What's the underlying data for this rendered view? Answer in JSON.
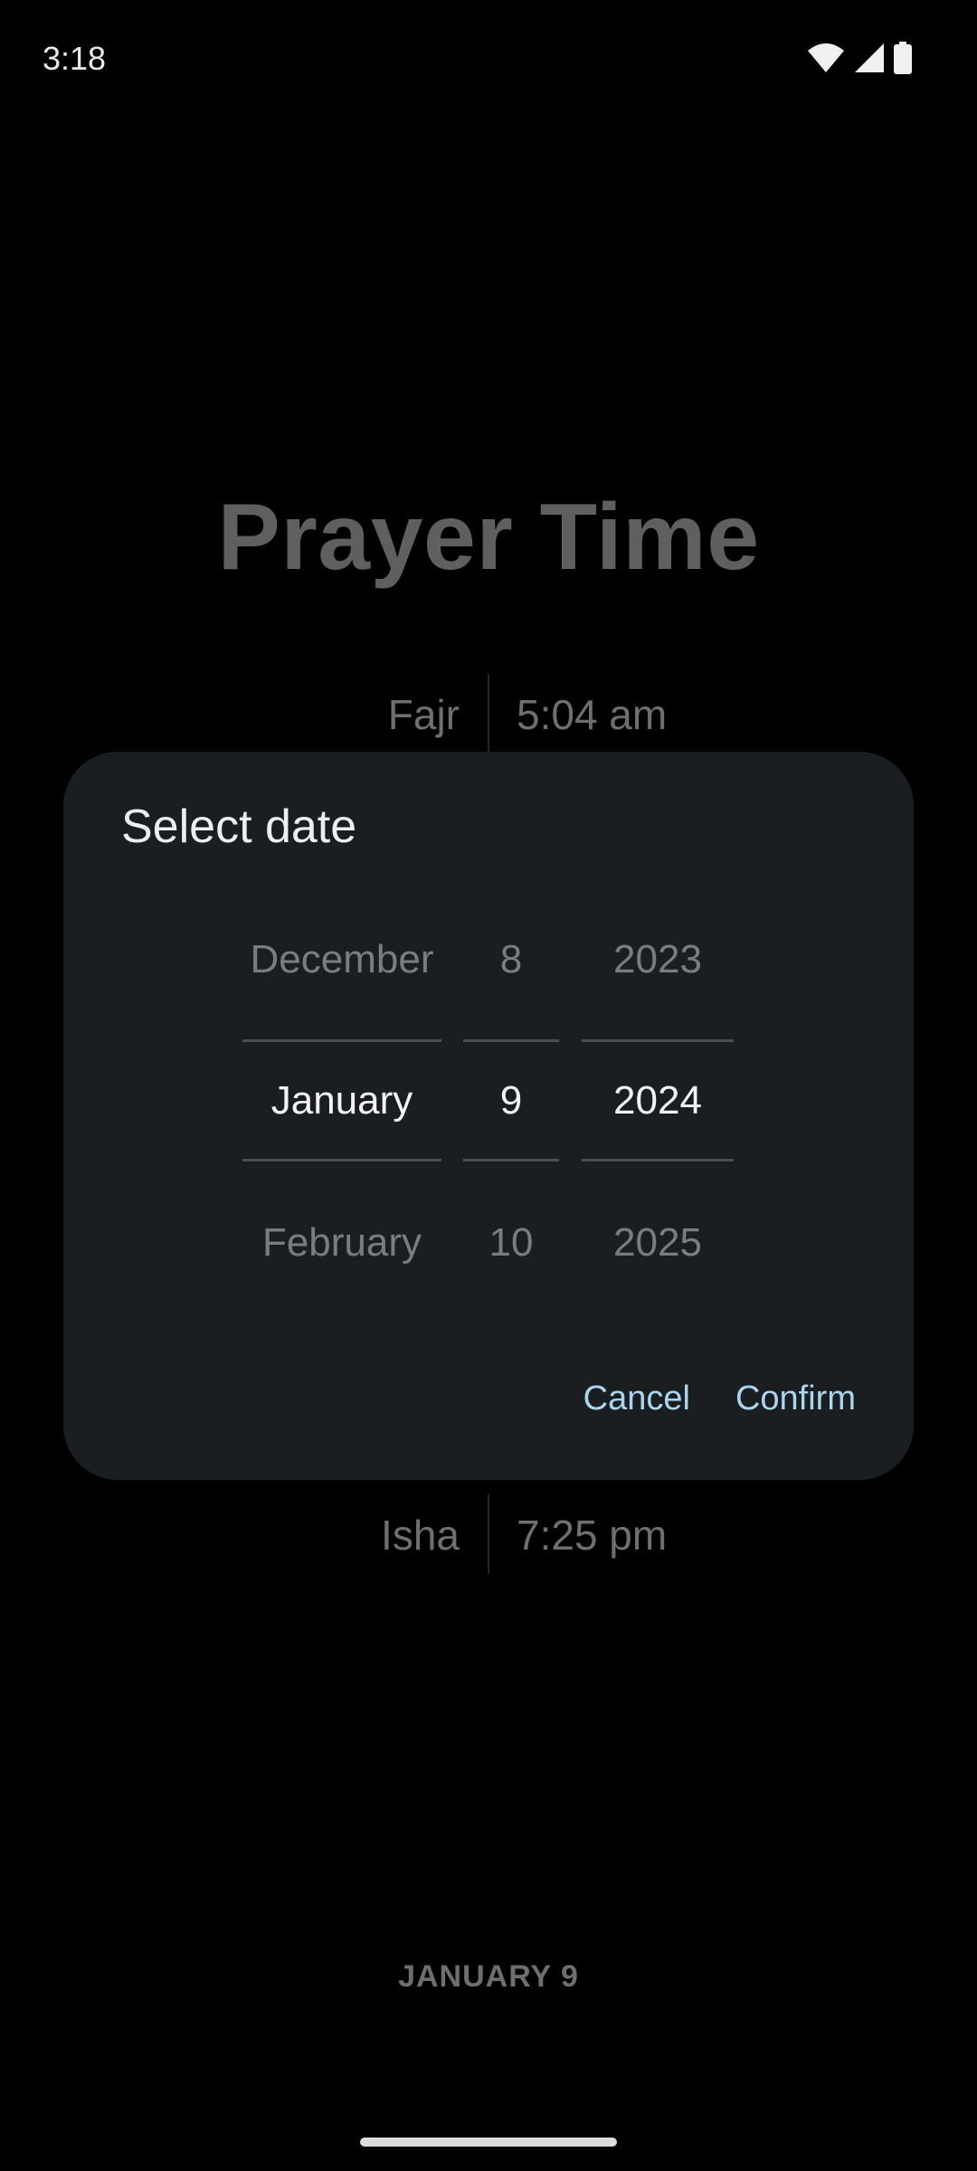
{
  "status_bar": {
    "time": "3:18",
    "icons": [
      "wifi-icon",
      "cell-signal-icon",
      "battery-icon"
    ]
  },
  "app": {
    "title": "Prayer Time",
    "prayers": {
      "fajr": {
        "name": "Fajr",
        "time": "5:04 am"
      },
      "isha": {
        "name": "Isha",
        "time": "7:25 pm"
      }
    },
    "date_label": "JANUARY 9"
  },
  "dialog": {
    "title": "Select date",
    "month": {
      "prev": "December",
      "selected": "January",
      "next": "February"
    },
    "day": {
      "prev": "8",
      "selected": "9",
      "next": "10"
    },
    "year": {
      "prev": "2023",
      "selected": "2024",
      "next": "2025"
    },
    "cancel_label": "Cancel",
    "confirm_label": "Confirm"
  },
  "colors": {
    "dialog_bg": "#1b1e21",
    "accent": "#a9d6ee",
    "background": "#000000"
  }
}
